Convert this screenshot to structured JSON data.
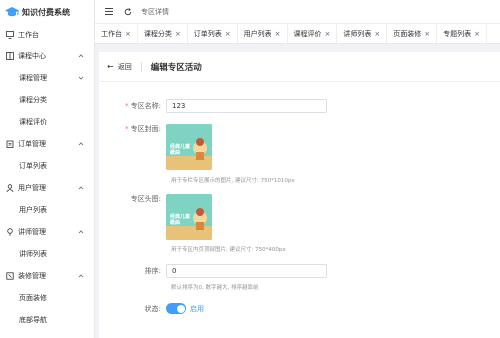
{
  "app": {
    "title": "知识付费系统"
  },
  "sidebar": {
    "items": [
      {
        "label": "工作台",
        "icon": "monitor-icon"
      },
      {
        "label": "课程中心",
        "icon": "book-icon",
        "children": [
          "课程管理",
          "课程分类",
          "课程评价"
        ]
      },
      {
        "label": "订单管理",
        "icon": "clipboard-icon",
        "children": [
          "订单列表"
        ]
      },
      {
        "label": "用户管理",
        "icon": "user-icon",
        "children": [
          "用户列表"
        ]
      },
      {
        "label": "讲师管理",
        "icon": "lecturer-icon",
        "children": [
          "讲师列表"
        ]
      },
      {
        "label": "装修管理",
        "icon": "decorate-icon",
        "children": [
          "页面装修",
          "底部导航"
        ]
      }
    ]
  },
  "header": {
    "breadcrumb": "专区详情"
  },
  "tabs": [
    "工作台",
    "课程分类",
    "订单列表",
    "用户列表",
    "课程评价",
    "讲师列表",
    "页面装修",
    "专题列表"
  ],
  "page": {
    "back_label": "返回",
    "title": "编辑专区活动"
  },
  "form": {
    "name": {
      "label": "专区名称:",
      "value": "123"
    },
    "cover": {
      "label": "专区封面:",
      "hint": "用于专栏专区展示的图片, 建议尺寸: 750*1010px",
      "image_text": "经典儿童\n歌曲"
    },
    "head": {
      "label": "专区头图:",
      "hint": "用于专区内页顶部图片, 建议尺寸: 750*400px",
      "image_text": "经典儿童\n歌曲"
    },
    "sort": {
      "label": "排序:",
      "value": "0",
      "hint": "默认排序为0, 数字越大, 排序越靠前"
    },
    "status": {
      "label": "状态:",
      "text": "启用",
      "on": true
    }
  },
  "colors": {
    "primary": "#409eff",
    "required": "#f56c6c",
    "logo": "#409eff"
  }
}
